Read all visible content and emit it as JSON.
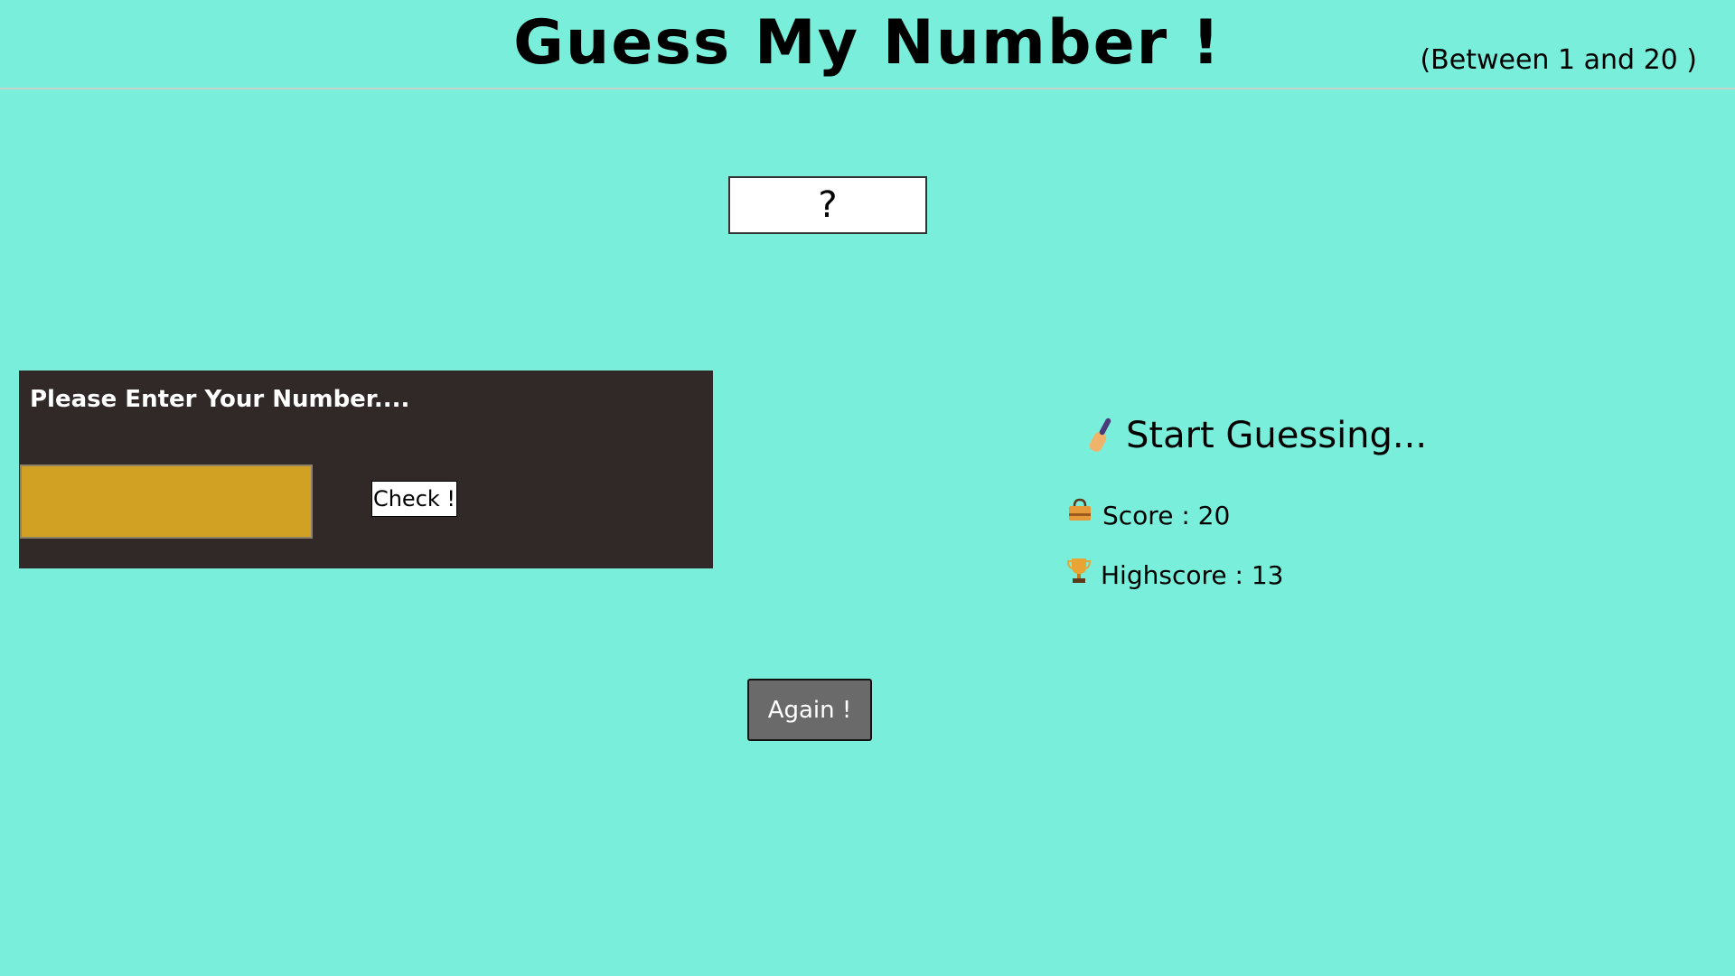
{
  "header": {
    "title": "Guess My Number !",
    "range_hint": "(Between 1 and 20 )"
  },
  "secret": {
    "value": "?"
  },
  "input_panel": {
    "label": "Please Enter Your Number....",
    "input_value": "",
    "check_label": "Check !"
  },
  "status": {
    "message": "Start Guessing...",
    "message_icon": "bat-icon",
    "score_label": "Score : 20",
    "score_icon": "bag-icon",
    "highscore_label": "Highscore : 13",
    "highscore_icon": "trophy-icon"
  },
  "actions": {
    "again_label": "Again !"
  },
  "colors": {
    "background": "#79efdb",
    "panel": "#312828",
    "input": "#d1a123",
    "again_button": "#6a6a6a"
  }
}
